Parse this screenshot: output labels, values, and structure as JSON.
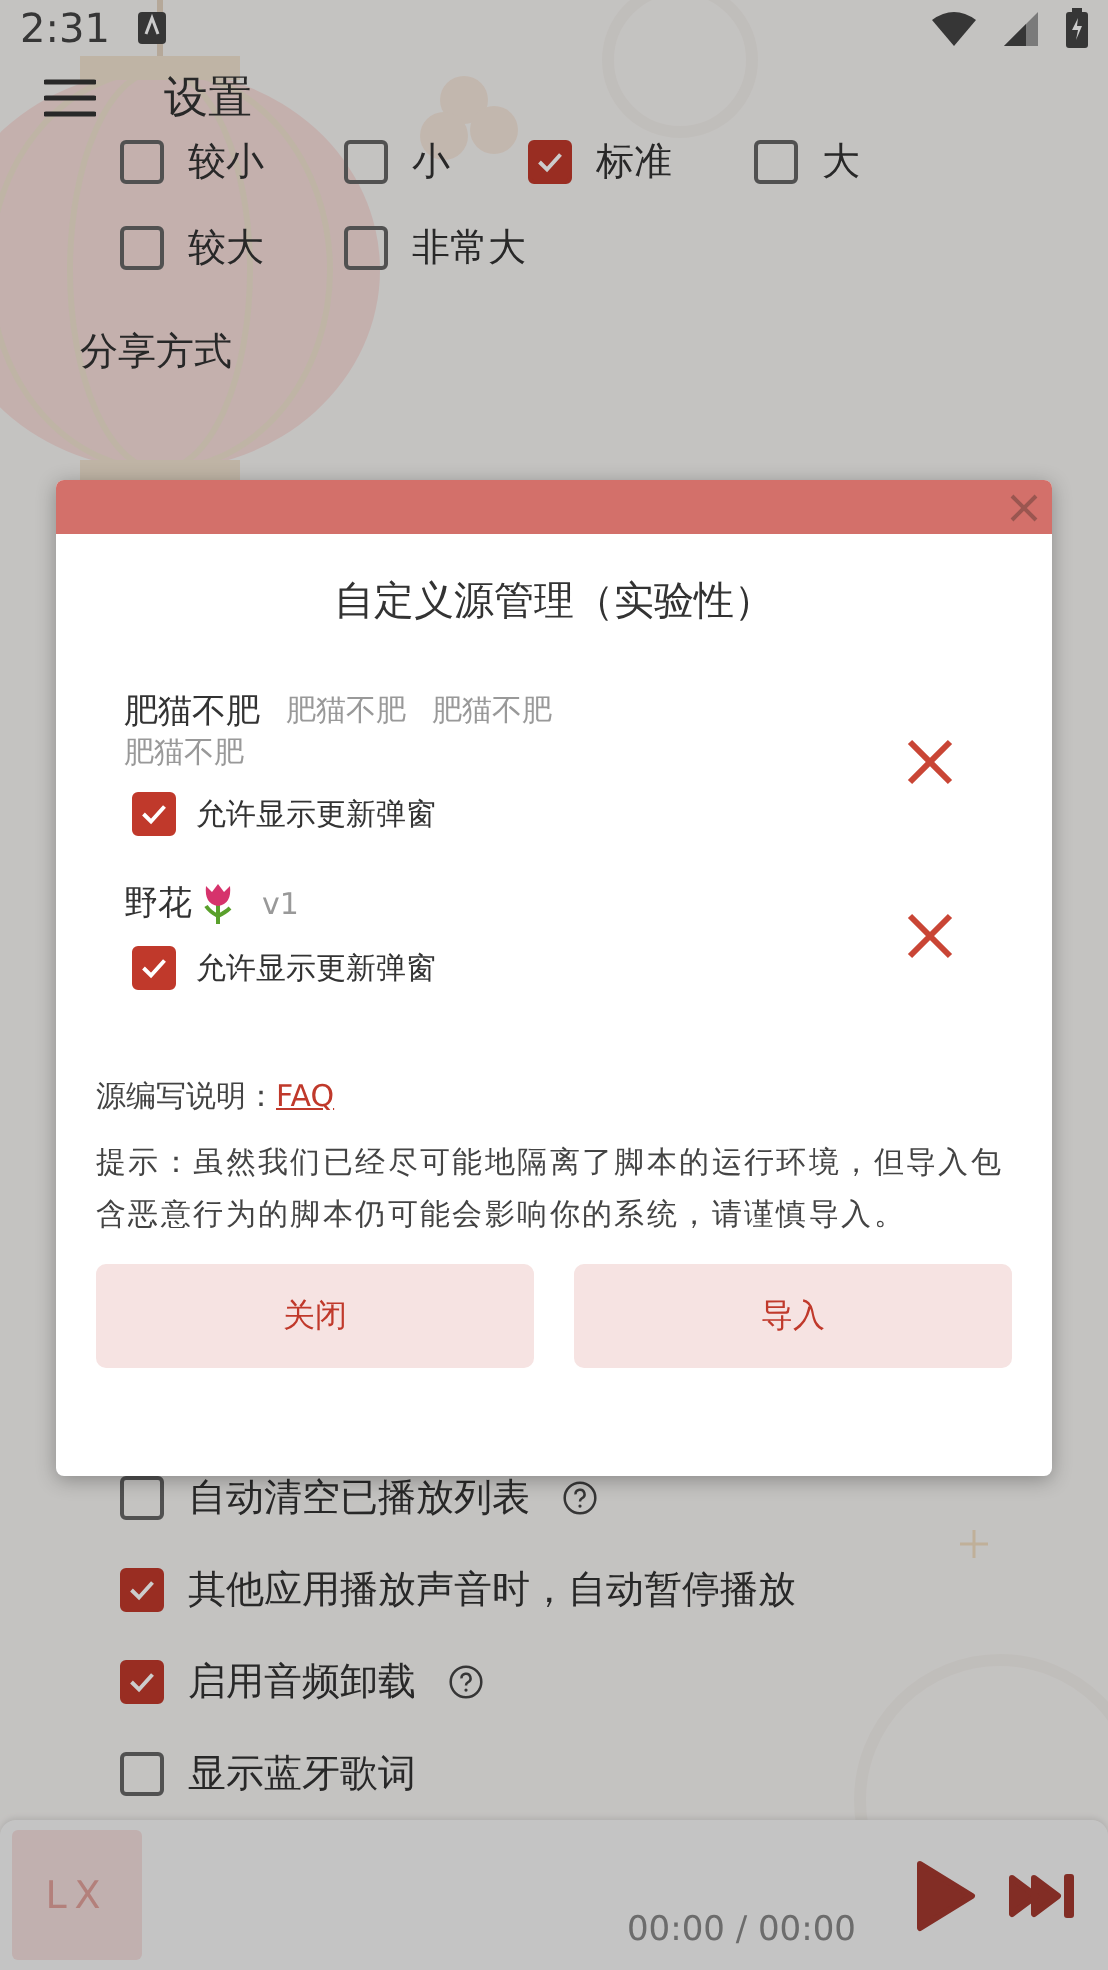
{
  "status_bar": {
    "time": "2:31"
  },
  "header": {
    "title": "设置"
  },
  "font_size_options": [
    {
      "label": "较小",
      "checked": false
    },
    {
      "label": "小",
      "checked": false
    },
    {
      "label": "标准",
      "checked": true
    },
    {
      "label": "大",
      "checked": false
    },
    {
      "label": "较大",
      "checked": false
    },
    {
      "label": "非常大",
      "checked": false
    }
  ],
  "share_section": {
    "title": "分享方式"
  },
  "playback_options": [
    {
      "label": "自动清空已播放列表",
      "checked": false,
      "help": true
    },
    {
      "label": "其他应用播放声音时，自动暂停播放",
      "checked": true,
      "help": false
    },
    {
      "label": "启用音频卸载",
      "checked": true,
      "help": true
    },
    {
      "label": "显示蓝牙歌词",
      "checked": false,
      "help": false
    }
  ],
  "dialog": {
    "title": "自定义源管理（实验性）",
    "sources": [
      {
        "name": "肥猫不肥",
        "kind": "plain",
        "details": [
          "肥猫不肥",
          "肥猫不肥",
          "肥猫不肥"
        ],
        "option": {
          "label": "允许显示更新弹窗",
          "checked": true
        }
      },
      {
        "name": "野花",
        "kind": "flower",
        "details": [
          "v1"
        ],
        "option": {
          "label": "允许显示更新弹窗",
          "checked": true
        }
      }
    ],
    "doc_label": "源编写说明：",
    "doc_link": "FAQ",
    "notice": "提示：虽然我们已经尽可能地隔离了脚本的运行环境，但导入包含恶意行为的脚本仍可能会影响你的系统，请谨慎导入。",
    "buttons": [
      "关闭",
      "导入"
    ]
  },
  "player": {
    "cover": "LX",
    "time": "00:00 / 00:00"
  }
}
